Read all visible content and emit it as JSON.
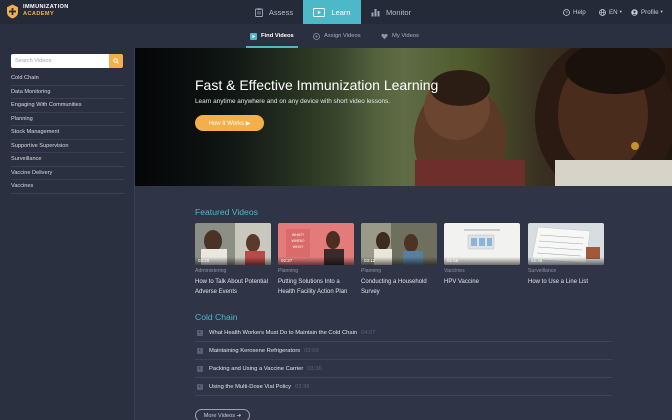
{
  "brand": {
    "line1": "IMMUNIZATION",
    "line2": "ACADEMY"
  },
  "nav": {
    "tabs": [
      {
        "label": "Assess",
        "icon": "clipboard-icon",
        "active": false
      },
      {
        "label": "Learn",
        "icon": "play-screen-icon",
        "active": true
      },
      {
        "label": "Monitor",
        "icon": "bar-chart-icon",
        "active": false
      }
    ],
    "help": "Help",
    "language": "EN",
    "profile": "Profile"
  },
  "subnav": {
    "tabs": [
      {
        "label": "Find Videos",
        "icon": "video-icon",
        "active": true
      },
      {
        "label": "Assign Videos",
        "icon": "assign-icon",
        "active": false
      },
      {
        "label": "My Videos",
        "icon": "heart-icon",
        "active": false
      }
    ]
  },
  "sidebar": {
    "search_placeholder": "Search Videos",
    "categories": [
      "Cold Chain",
      "Data Monitoring",
      "Engaging With Communities",
      "Planning",
      "Stock Management",
      "Supportive Supervision",
      "Surveillance",
      "Vaccine Delivery",
      "Vaccines"
    ]
  },
  "hero": {
    "title": "Fast & Effective Immunization Learning",
    "subtitle": "Learn anytime anywhere and on any device with short video lessons.",
    "button": "How It Works ▶"
  },
  "featured": {
    "title": "Featured Videos",
    "videos": [
      {
        "category": "Administering",
        "title": "How to Talk About Potential Adverse Events",
        "duration": "03:20"
      },
      {
        "category": "Planning",
        "title": "Putting Solutions Into a Health Facility Action Plan",
        "duration": "02:27"
      },
      {
        "category": "Planning",
        "title": "Conducting a Household Survey",
        "duration": "03:12"
      },
      {
        "category": "Vaccines",
        "title": "HPV Vaccine",
        "duration": "01:56"
      },
      {
        "category": "Surveillance",
        "title": "How to Use a Line List",
        "duration": "02:45"
      }
    ]
  },
  "cold_chain": {
    "title": "Cold Chain",
    "items": [
      {
        "title": "What Health Workers Must Do to Maintain the Cold Chain",
        "duration": "04:07"
      },
      {
        "title": "Maintaining Kerosene Refrigerators",
        "duration": "03:09"
      },
      {
        "title": "Packing and Using a Vaccine Carrier",
        "duration": "03:36"
      },
      {
        "title": "Using the Multi-Dose Vial Policy",
        "duration": "03:36"
      }
    ],
    "more_button": "More Videos ➔"
  },
  "colors": {
    "accent": "#4cb8c8",
    "brand_orange": "#f3b04a",
    "background": "#2f3446"
  }
}
